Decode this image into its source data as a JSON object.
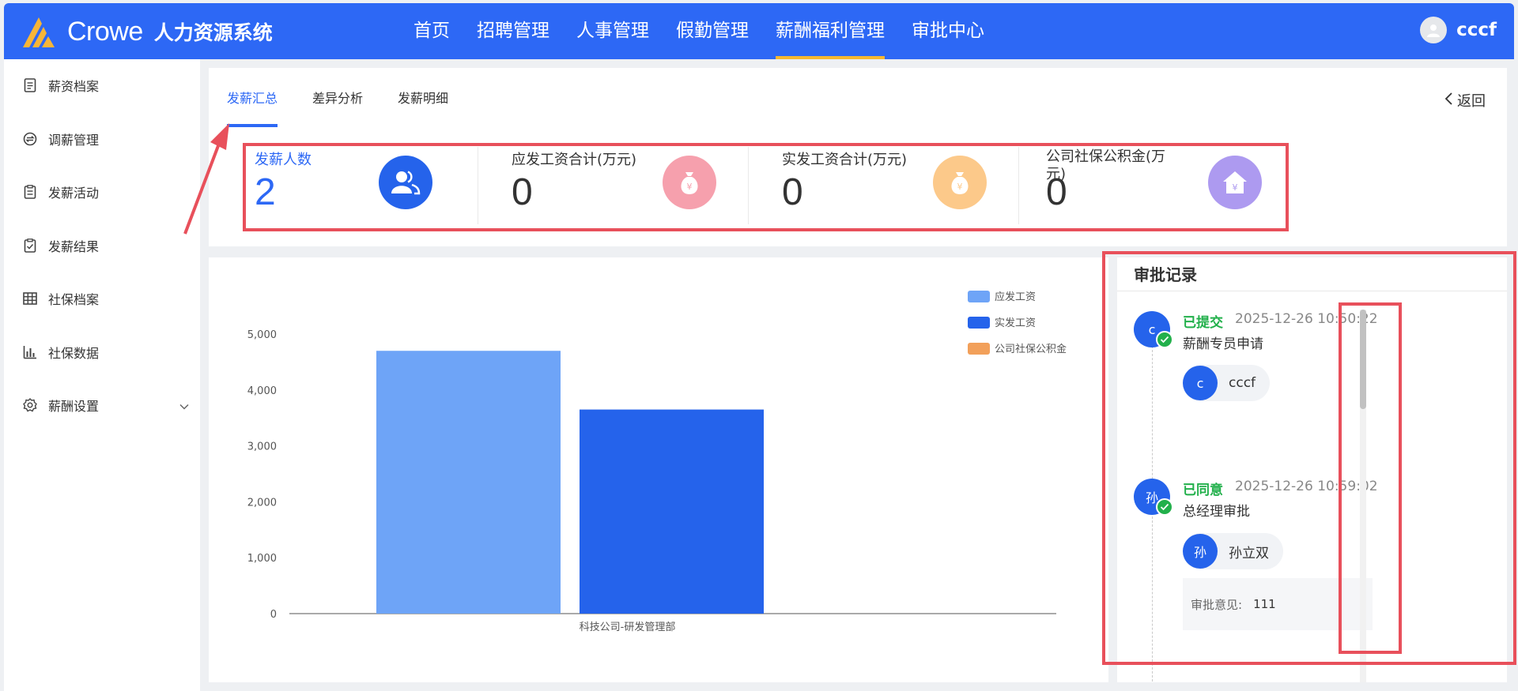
{
  "header": {
    "brand": "Crowe",
    "system_name": "人力资源系统",
    "nav": [
      "首页",
      "招聘管理",
      "人事管理",
      "假勤管理",
      "薪酬福利管理",
      "审批中心"
    ],
    "active_nav": "薪酬福利管理",
    "user_name": "cccf",
    "accent_color": "#2d68f5",
    "nav_underline_color": "#f5b731"
  },
  "sidebar": {
    "items": [
      {
        "label": "薪资档案",
        "icon": "file-icon"
      },
      {
        "label": "调薪管理",
        "icon": "exchange-icon"
      },
      {
        "label": "发薪活动",
        "icon": "clipboard-icon"
      },
      {
        "label": "发薪结果",
        "icon": "clipboard-check-icon"
      },
      {
        "label": "社保档案",
        "icon": "grid-icon"
      },
      {
        "label": "社保数据",
        "icon": "bar-chart-icon"
      },
      {
        "label": "薪酬设置",
        "icon": "gear-icon"
      }
    ]
  },
  "tabs": {
    "items": [
      "发薪汇总",
      "差异分析",
      "发薪明细"
    ],
    "active": "发薪汇总",
    "back_label": "返回"
  },
  "stats": [
    {
      "label": "发薪人数",
      "value": "2",
      "icon": "users-icon",
      "color": "#2563eb"
    },
    {
      "label": "应发工资合计(万元)",
      "value": "0",
      "icon": "money-bag-icon",
      "color": "#f6a0ad"
    },
    {
      "label": "实发工资合计(万元)",
      "value": "0",
      "icon": "money-bag-icon",
      "color": "#fcc98a"
    },
    {
      "label": "公司社保公积金(万元)",
      "value": "0",
      "icon": "house-icon",
      "color": "#ad9af0"
    }
  ],
  "chart_data": {
    "type": "bar",
    "categories": [
      "科技公司-研发管理部"
    ],
    "series": [
      {
        "name": "应发工资",
        "values": [
          4700
        ],
        "color": "#6ea4f7"
      },
      {
        "name": "实发工资",
        "values": [
          3650
        ],
        "color": "#2563eb"
      },
      {
        "name": "公司社保公积金",
        "values": [
          0
        ],
        "color": "#f2a05a"
      }
    ],
    "yticks": [
      "0",
      "1,000",
      "2,000",
      "3,000",
      "4,000",
      "5,000"
    ],
    "ylim": [
      0,
      5000
    ],
    "legend_position": "top-right"
  },
  "approval": {
    "title": "审批记录",
    "records": [
      {
        "avatar": "c",
        "status": "已提交",
        "time": "2025-12-26 10:50:22",
        "desc": "薪酬专员申请",
        "person_avatar": "c",
        "person": "cccf",
        "opinion_label": "",
        "opinion": ""
      },
      {
        "avatar": "孙",
        "status": "已同意",
        "time": "2025-12-26 10:59:02",
        "desc": "总经理审批",
        "person_avatar": "孙",
        "person": "孙立双",
        "opinion_label": "审批意见:",
        "opinion": "111"
      }
    ],
    "status_color": "#22b04b"
  }
}
